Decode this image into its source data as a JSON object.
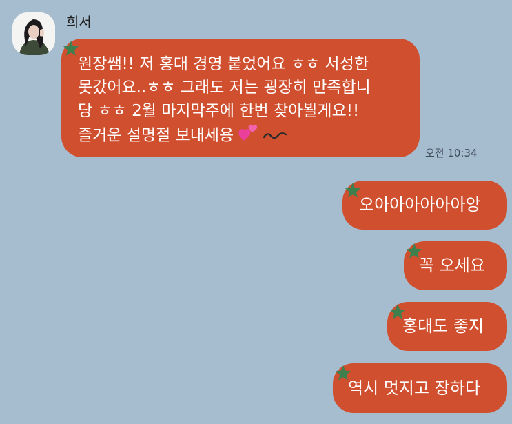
{
  "chat": {
    "sender_name": "희서",
    "received_message": {
      "lines": [
        "원장쌤!! 저 홍대 경영 붙었어요 ㅎㅎ 서성한",
        "못갔어요..ㅎㅎ 그래도 저는 굉장히 만족합니",
        "당 ㅎㅎ 2월 마지막주에 한번 찾아뵐게요!!",
        "즐거운 설명절 보내세용"
      ],
      "emoji_icons": [
        "two-hearts-icon",
        "wavy-dash-icon"
      ],
      "time": "오전 10:34"
    },
    "sent_messages": [
      {
        "text": "오아아아아아아앙"
      },
      {
        "text": "꼭 오세요"
      },
      {
        "text": "홍대도 좋지"
      },
      {
        "text": "역시 멋지고 장하다"
      }
    ]
  },
  "colors": {
    "background": "#a6bccf",
    "bubble": "#d04f2e",
    "bubble_text": "#ffffff",
    "star_sticker": "#3e7f4e"
  }
}
